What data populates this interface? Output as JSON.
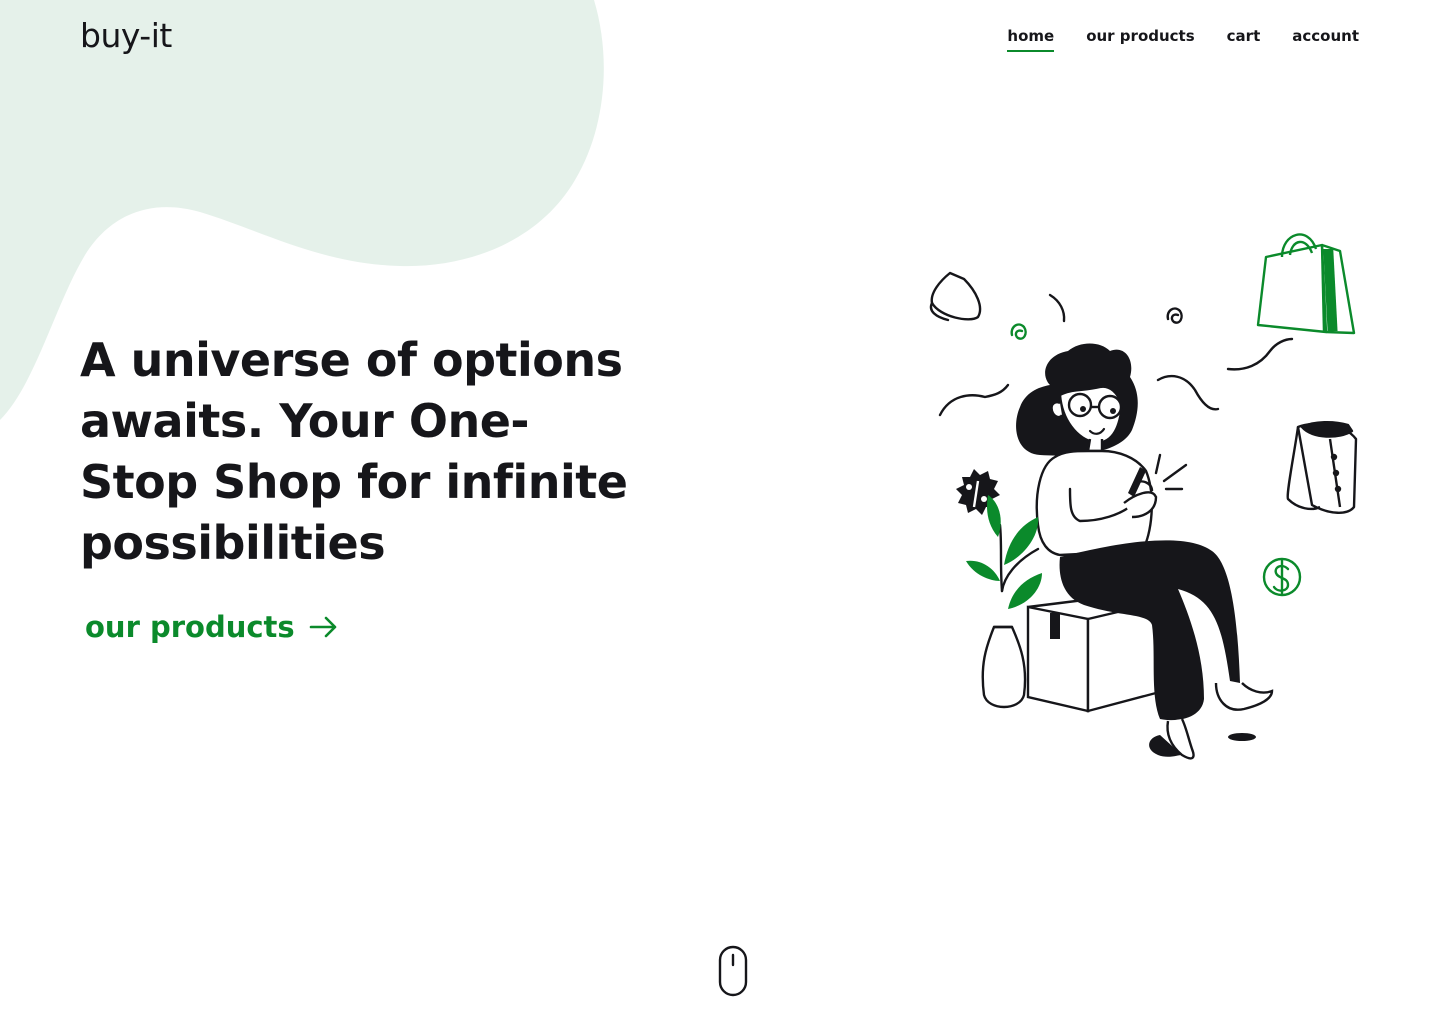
{
  "brand": {
    "logo": "buy-it",
    "accent_color": "#0b8a2b",
    "blob_color": "#e5f1ea",
    "text_color": "#16161a"
  },
  "nav": {
    "items": [
      {
        "label": "home",
        "active": true
      },
      {
        "label": "our products",
        "active": false
      },
      {
        "label": "cart",
        "active": false
      },
      {
        "label": "account",
        "active": false
      }
    ]
  },
  "hero": {
    "headline": "A universe of options awaits. Your One-Stop Shop for infinite possibilities",
    "cta_label": "our products",
    "cta_icon": "arrow-right-icon"
  },
  "illustration": {
    "icons": [
      "shopping-bag-icon",
      "cup-icon",
      "shirt-icon",
      "discount-badge-icon",
      "dollar-coin-icon",
      "plant-icon",
      "box-icon",
      "phone-icon"
    ]
  },
  "scroll_indicator": {
    "icon": "mouse-scroll-icon"
  }
}
